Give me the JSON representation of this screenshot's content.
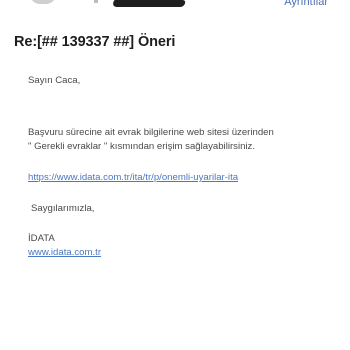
{
  "header": {
    "top_right_text": "Ayrıntılar"
  },
  "email": {
    "subject": "Re:[## 139337 ##] Öneri",
    "greeting": "Sayın Caca,",
    "body_line1": "Başvuru sürecine ait evrak bilgilerine web sitesi üzerinden",
    "body_line2": "\" Gerekli evraklar \" kısmından erişim sağlayabilirsiniz.",
    "link_url": "https://www.idata.com.tr/ita/tr/p/onemli-uyarilar-ita",
    "closing": "Saygılarımızla,",
    "signature_name": "İDATA",
    "signature_link": "www.idata.com.tr"
  }
}
